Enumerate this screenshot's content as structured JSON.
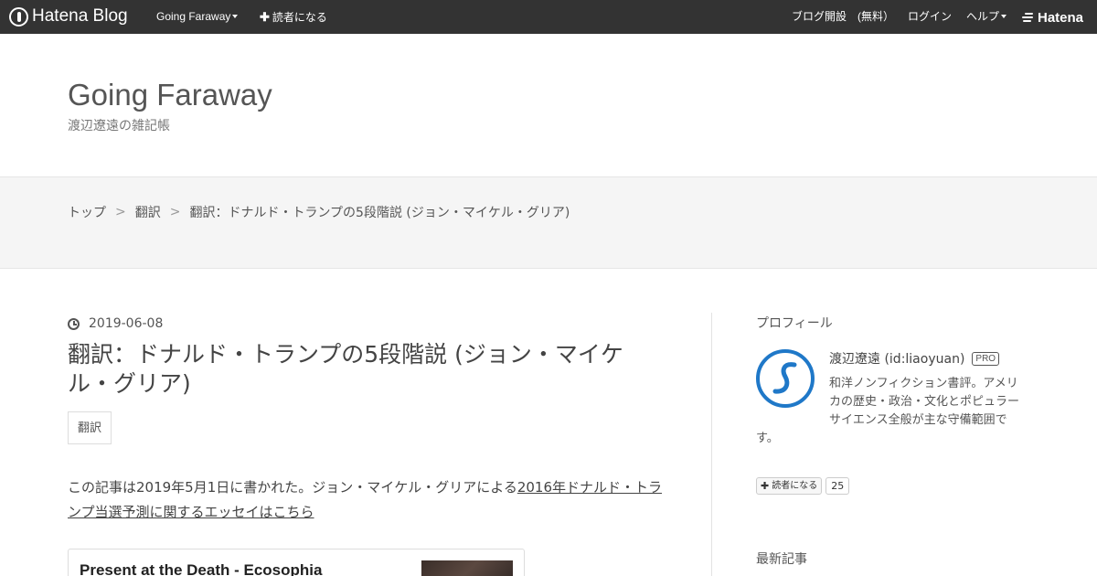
{
  "topbar": {
    "brand": "Hatena Blog",
    "blog_menu": "Going Faraway",
    "subscribe": "読者になる",
    "open_blog": "ブログ開設　(無料）",
    "login": "ログイン",
    "help": "ヘルプ",
    "hatena": "Hatena"
  },
  "header": {
    "title": "Going Faraway",
    "description": "渡辺遼遠の雑記帳"
  },
  "breadcrumb": {
    "items": [
      "トップ",
      "翻訳",
      "翻訳：ドナルド・トランプの5段階説 (ジョン・マイケル・グリア)"
    ],
    "separator": ">"
  },
  "article": {
    "date": "2019-06-08",
    "title": "翻訳：ドナルド・トランプの5段階説 (ジョン・マイケル・グリア)",
    "category": "翻訳",
    "intro_text": "この記事は2019年5月1日に書かれた。ジョン・マイケル・グリアによる",
    "intro_link": "2016年ドナルド・トランプ当選予測に関するエッセイはこちら",
    "embed_title": "Present at the Death - Ecosophia"
  },
  "sidebar": {
    "profile_heading": "プロフィール",
    "profile_name": "渡辺遼遠 (id:liaoyuan)",
    "pro_badge": "PRO",
    "profile_desc_lines": [
      "和洋ノンフィクション書評。アメリ",
      "カの歴史・政治・文化とポピュラー",
      "サイエンス全般が主な守備範囲で",
      "す。"
    ],
    "reader_button": "読者になる",
    "reader_count": "25",
    "recent_heading": "最新記事"
  },
  "colors": {
    "topbar_bg": "#333333",
    "avatar_accent": "#1f78c8",
    "band_bg": "#f5f5f5"
  }
}
